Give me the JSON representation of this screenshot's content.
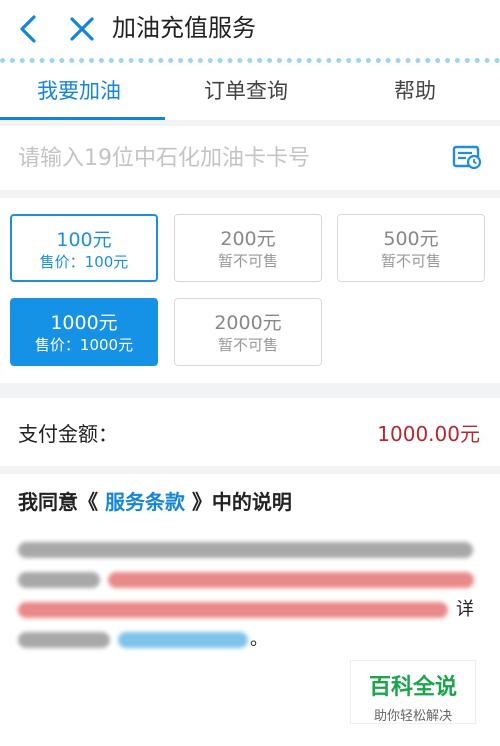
{
  "header": {
    "title": "加油充值服务",
    "back_icon": "chevron-left-icon",
    "close_icon": "close-icon"
  },
  "tabs": [
    {
      "label": "我要加油",
      "active": true
    },
    {
      "label": "订单查询",
      "active": false
    },
    {
      "label": "帮助",
      "active": false
    }
  ],
  "card_input": {
    "placeholder": "请输入19位中石化加油卡卡号",
    "value": "",
    "icon": "card-scan-icon"
  },
  "amount_options": [
    {
      "value": "100元",
      "sub": "售价：100元",
      "state": "outlined"
    },
    {
      "value": "200元",
      "sub": "暂不可售",
      "state": "disabled"
    },
    {
      "value": "500元",
      "sub": "暂不可售",
      "state": "disabled"
    },
    {
      "value": "1000元",
      "sub": "售价：1000元",
      "state": "selected"
    },
    {
      "value": "2000元",
      "sub": "暂不可售",
      "state": "disabled"
    }
  ],
  "payment": {
    "label": "支付金额：",
    "amount": "1000.00元"
  },
  "agreement": {
    "prefix": "我同意《",
    "link": "服务条款",
    "suffix": "》中的说明",
    "notice_visible_1": "详",
    "notice_visible_2": "。"
  },
  "watermark": {
    "main": "百科全说",
    "sub": "助你轻松解决"
  },
  "colors": {
    "accent": "#1585d8",
    "selected_bg": "#1592e6",
    "amount_red": "#b5282f",
    "brand_green": "#1aa54a"
  }
}
